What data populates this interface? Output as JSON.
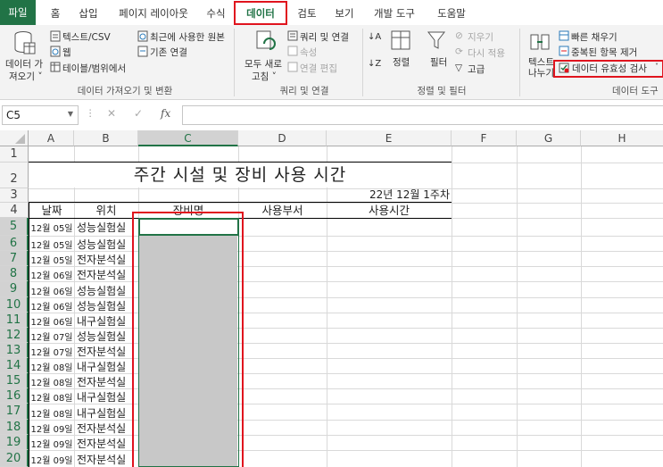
{
  "ribbon_tabs": [
    "파일",
    "홈",
    "삽입",
    "페이지 레이아웃",
    "수식",
    "데이터",
    "검토",
    "보기",
    "개발 도구",
    "도움말"
  ],
  "ribbon": {
    "get_data": {
      "line1": "데이터 가",
      "line2": "져오기 ˅"
    },
    "text_csv": "텍스트/CSV",
    "web": "웹",
    "table_range": "테이블/범위에서",
    "recent_sources": "최근에 사용한 원본",
    "existing_conn": "기존 연결",
    "group_get_transform": "데이터 가져오기 및 변환",
    "refresh_all": {
      "line1": "모두 새로",
      "line2": "고침 ˅"
    },
    "queries_conn": "쿼리 및 연결",
    "properties": "속성",
    "edit_links": "연결 편집",
    "group_queries": "쿼리 및 연결",
    "sort": "정렬",
    "filter": "필터",
    "clear": "지우기",
    "reapply": "다시 적용",
    "advanced": "고급",
    "group_sort_filter": "정렬 및 필터",
    "text_to_columns": {
      "line1": "텍스트",
      "line2": "나누기"
    },
    "flash_fill": "빠른 채우기",
    "remove_dup": "중복된 항목 제거",
    "data_validation": "데이터 유효성 검사",
    "group_data_tools": "데이터 도구"
  },
  "formula_bar": {
    "name_box": "C5",
    "fx": "fx",
    "formula": ""
  },
  "columns": [
    "A",
    "B",
    "C",
    "D",
    "E",
    "F",
    "G",
    "H"
  ],
  "rows": [
    "1",
    "2",
    "3",
    "4",
    "5",
    "6",
    "7",
    "8",
    "9",
    "10",
    "11",
    "12",
    "13",
    "14",
    "15",
    "16",
    "17",
    "18",
    "19",
    "20"
  ],
  "sheet": {
    "title": "주간 시설 및 장비 사용 시간",
    "week": "22년 12월 1주차",
    "headers": {
      "date": "날짜",
      "location": "위치",
      "equipment": "장비명",
      "department": "사용부서",
      "time": "사용시간"
    },
    "data_rows": [
      {
        "date": "12월 05일",
        "location": "성능실험실"
      },
      {
        "date": "12월 05일",
        "location": "성능실험실"
      },
      {
        "date": "12월 05일",
        "location": "전자분석실"
      },
      {
        "date": "12월 06일",
        "location": "전자분석실"
      },
      {
        "date": "12월 06일",
        "location": "성능실험실"
      },
      {
        "date": "12월 06일",
        "location": "성능실험실"
      },
      {
        "date": "12월 06일",
        "location": "내구실험실"
      },
      {
        "date": "12월 07일",
        "location": "성능실험실"
      },
      {
        "date": "12월 07일",
        "location": "전자분석실"
      },
      {
        "date": "12월 08일",
        "location": "내구실험실"
      },
      {
        "date": "12월 08일",
        "location": "전자분석실"
      },
      {
        "date": "12월 08일",
        "location": "내구실험실"
      },
      {
        "date": "12월 08일",
        "location": "내구실험실"
      },
      {
        "date": "12월 09일",
        "location": "전자분석실"
      },
      {
        "date": "12월 09일",
        "location": "전자분석실"
      },
      {
        "date": "12월 09일",
        "location": "전자분석실"
      }
    ]
  },
  "colors": {
    "excel_green": "#217346",
    "highlight_red": "#e0141e",
    "selection_gray": "#c8c8c8"
  }
}
